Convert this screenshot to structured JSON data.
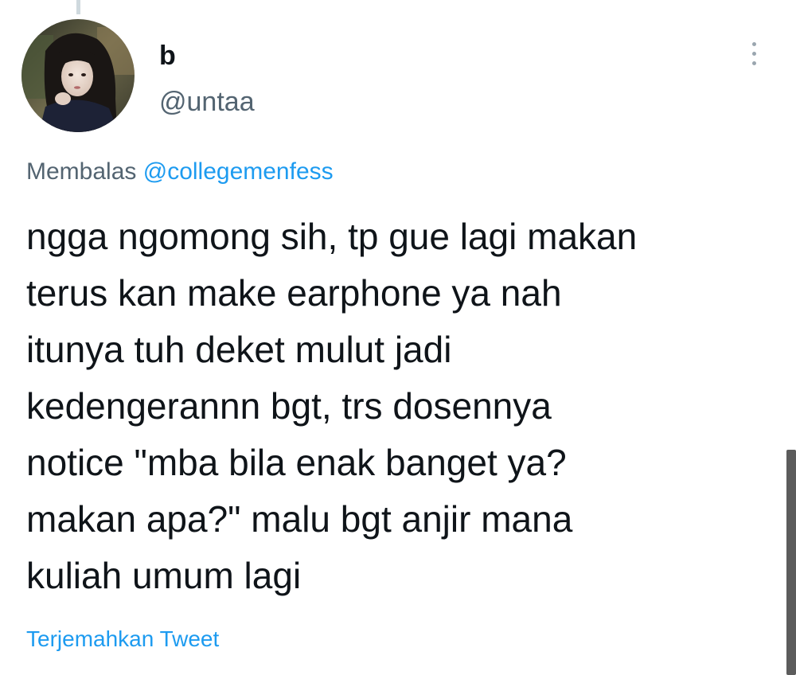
{
  "tweet": {
    "author": {
      "display_name": "b",
      "handle": "@untaa"
    },
    "reply_context": {
      "prefix": "Membalas",
      "mention": "@collegemenfess"
    },
    "text_lines": [
      "ngga ngomong sih, tp gue lagi makan",
      "terus kan make earphone ya nah",
      "itunya tuh deket mulut jadi",
      "kedengerannn bgt, trs dosennya",
      "notice \"mba bila enak banget ya?",
      "makan apa?\" malu bgt anjir mana",
      "kuliah umum lagi"
    ],
    "translate_label": "Terjemahkan Tweet"
  },
  "icons": {
    "more": "more-vertical-icon"
  },
  "colors": {
    "text_primary": "#0f1419",
    "text_secondary": "#536471",
    "link_blue": "#1d9bf0",
    "thread_line": "#cfd9de"
  }
}
